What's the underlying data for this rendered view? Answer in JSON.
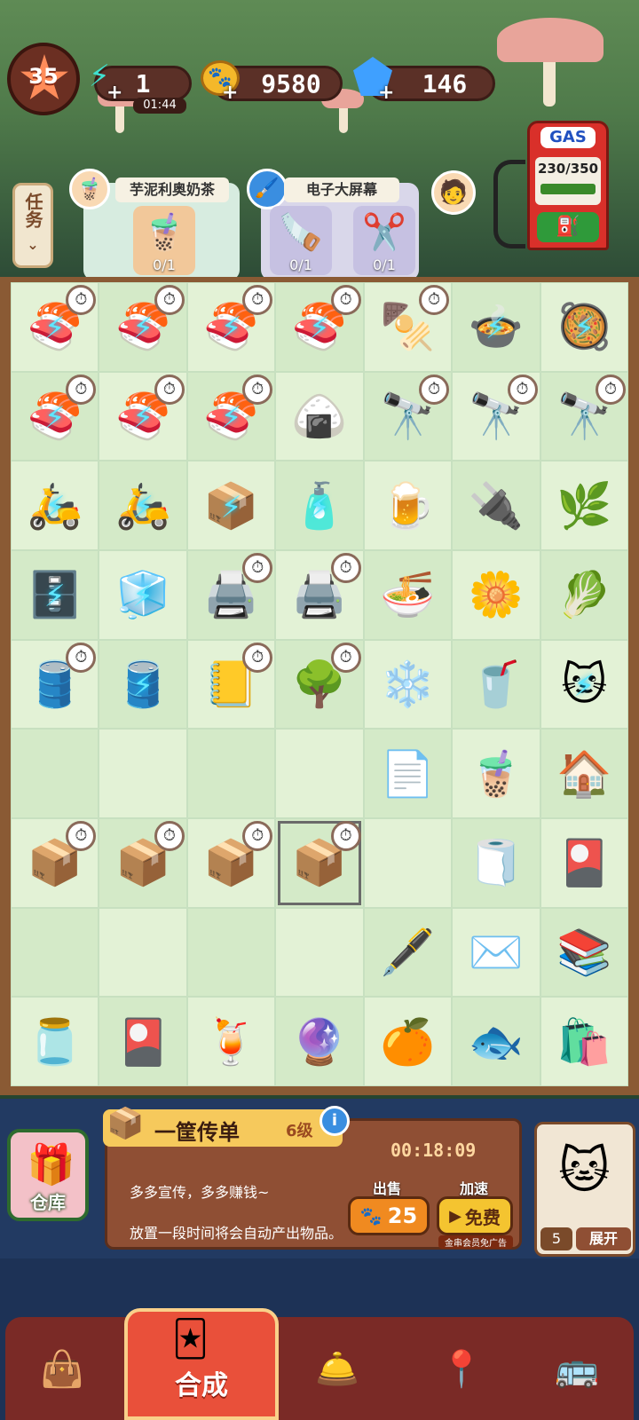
{
  "hud": {
    "level": "35",
    "energy": {
      "value": "1",
      "timer": "01:44",
      "icon": "energy-icon"
    },
    "coins": {
      "value": "9580",
      "icon": "paw-coin-icon"
    },
    "gems": {
      "value": "146",
      "icon": "gem-icon"
    },
    "gas": {
      "label": "GAS",
      "value": "230/350"
    }
  },
  "tasks": {
    "tab_label": "任务",
    "orders": [
      {
        "title": "芋泥利奥奶茶",
        "items": [
          {
            "icon": "bubble-tea-icon",
            "glyph": "🧋",
            "progress": "0/1"
          }
        ]
      },
      {
        "title": "电子大屏幕",
        "items": [
          {
            "icon": "saw-icon",
            "glyph": "🪚",
            "progress": "0/1"
          },
          {
            "icon": "eyelash-curler-icon",
            "glyph": "✂️",
            "progress": "0/1"
          }
        ]
      }
    ]
  },
  "board": {
    "rows": [
      [
        {
          "icon": "sushi-roll-icon",
          "g": "🍣",
          "lock": true,
          "timer": true
        },
        {
          "icon": "sushi-roll-icon",
          "g": "🍣",
          "lock": true,
          "timer": true
        },
        {
          "icon": "sushi-roll-icon",
          "g": "🍣",
          "lock": true,
          "timer": true
        },
        {
          "icon": "sushi-roll-icon",
          "g": "🍣",
          "lock": true,
          "timer": true
        },
        {
          "icon": "hotpot-icon",
          "g": "🍢",
          "lock": false,
          "timer": true
        },
        {
          "icon": "stew-pot-icon",
          "g": "🍲",
          "lock": true,
          "timer": false
        },
        {
          "icon": "soup-bowl-icon",
          "g": "🥘",
          "lock": true,
          "timer": false
        }
      ],
      [
        {
          "icon": "sushi-roll-icon",
          "g": "🍣",
          "lock": true,
          "timer": true
        },
        {
          "icon": "sushi-roll-icon",
          "g": "🍣",
          "lock": true,
          "timer": true
        },
        {
          "icon": "sushi-roll-icon",
          "g": "🍣",
          "lock": true,
          "timer": true
        },
        {
          "icon": "sushi-roll-icon",
          "g": "🍙",
          "lock": false,
          "timer": false
        },
        {
          "icon": "telescope-icon",
          "g": "🔭",
          "lock": false,
          "timer": true
        },
        {
          "icon": "telescope-icon",
          "g": "🔭",
          "lock": false,
          "timer": true
        },
        {
          "icon": "telescope-icon",
          "g": "🔭",
          "lock": false,
          "timer": true
        }
      ],
      [
        {
          "icon": "scooter-icon",
          "g": "🛵",
          "lock": true,
          "timer": false
        },
        {
          "icon": "scooter-icon",
          "g": "🛵",
          "lock": true,
          "timer": false
        },
        {
          "icon": "crafts-box-icon",
          "g": "📦",
          "lock": true,
          "timer": false
        },
        {
          "icon": "bottles-crate-icon",
          "g": "🧴",
          "lock": true,
          "timer": false
        },
        {
          "icon": "beer-glass-icon",
          "g": "🍺",
          "lock": false,
          "timer": false
        },
        {
          "icon": "plug-icon",
          "g": "🔌",
          "lock": false,
          "timer": false
        },
        {
          "icon": "herbs-board-icon",
          "g": "🌿",
          "lock": false,
          "timer": false
        }
      ],
      [
        {
          "icon": "safe-icon",
          "g": "🗄️",
          "lock": true,
          "timer": false
        },
        {
          "icon": "fridge-icon",
          "g": "🧊",
          "lock": true,
          "timer": false
        },
        {
          "icon": "printer-icon",
          "g": "🖨️",
          "lock": false,
          "timer": true
        },
        {
          "icon": "printer-icon",
          "g": "🖨️",
          "lock": false,
          "timer": true
        },
        {
          "icon": "noodle-bowl-icon",
          "g": "🍜",
          "lock": false,
          "timer": false
        },
        {
          "icon": "flower-icon",
          "g": "🌼",
          "lock": false,
          "timer": false
        },
        {
          "icon": "cabbage-icon",
          "g": "🥬",
          "lock": false,
          "timer": false
        }
      ],
      [
        {
          "icon": "barrel-icon",
          "g": "🛢️",
          "lock": false,
          "timer": true
        },
        {
          "icon": "barrel-icon",
          "g": "🛢️",
          "lock": true,
          "timer": false
        },
        {
          "icon": "notebook-icon",
          "g": "📒",
          "lock": false,
          "timer": true
        },
        {
          "icon": "tree-icon",
          "g": "🌳",
          "lock": false,
          "timer": true
        },
        {
          "icon": "snowflake-icon",
          "g": "❄️",
          "lock": false,
          "timer": false
        },
        {
          "icon": "purple-drink-icon",
          "g": "🥤",
          "lock": false,
          "timer": false
        },
        {
          "icon": "lucky-cat-icon",
          "g": "🐱",
          "lock": true,
          "timer": false
        }
      ],
      [
        {
          "icon": "",
          "g": "",
          "lock": false,
          "timer": false
        },
        {
          "icon": "",
          "g": "",
          "lock": false,
          "timer": false
        },
        {
          "icon": "",
          "g": "",
          "lock": false,
          "timer": false
        },
        {
          "icon": "",
          "g": "",
          "lock": false,
          "timer": false
        },
        {
          "icon": "paper-plane-icon",
          "g": "📄",
          "lock": false,
          "timer": false
        },
        {
          "icon": "iced-cola-icon",
          "g": "🧋",
          "lock": false,
          "timer": false
        },
        {
          "icon": "house-icon",
          "g": "🏠",
          "lock": false,
          "timer": false
        }
      ],
      [
        {
          "icon": "flyer-box-icon",
          "g": "📦",
          "lock": false,
          "timer": true
        },
        {
          "icon": "flyer-box-icon",
          "g": "📦",
          "lock": false,
          "timer": true
        },
        {
          "icon": "flyer-box-icon",
          "g": "📦",
          "lock": false,
          "timer": true
        },
        {
          "icon": "flyer-box-icon",
          "g": "📦",
          "lock": false,
          "timer": true
        },
        {
          "icon": "",
          "g": "",
          "lock": false,
          "timer": false
        },
        {
          "icon": "paper-sheet-icon",
          "g": "🧻",
          "lock": false,
          "timer": false
        },
        {
          "icon": "flyer-cards-icon",
          "g": "🎴",
          "lock": false,
          "timer": false
        }
      ],
      [
        {
          "icon": "",
          "g": "",
          "lock": false,
          "timer": false
        },
        {
          "icon": "",
          "g": "",
          "lock": false,
          "timer": false
        },
        {
          "icon": "",
          "g": "",
          "lock": false,
          "timer": false
        },
        {
          "icon": "",
          "g": "",
          "lock": false,
          "timer": false
        },
        {
          "icon": "fountain-pen-icon",
          "g": "🖋️",
          "lock": false,
          "timer": false
        },
        {
          "icon": "envelope-icon",
          "g": "✉️",
          "lock": false,
          "timer": false
        },
        {
          "icon": "paper-stack-icon",
          "g": "📚",
          "lock": false,
          "timer": false
        }
      ],
      [
        {
          "icon": "jam-jar-icon",
          "g": "🫙",
          "lock": false,
          "timer": false
        },
        {
          "icon": "flyer-cards-icon",
          "g": "🎴",
          "lock": false,
          "timer": false
        },
        {
          "icon": "berry-drink-icon",
          "g": "🍹",
          "lock": false,
          "timer": false
        },
        {
          "icon": "crystal-ball-icon",
          "g": "🔮",
          "lock": false,
          "timer": false
        },
        {
          "icon": "orange-juice-icon",
          "g": "🍊",
          "lock": false,
          "timer": false
        },
        {
          "icon": "fish-figure-icon",
          "g": "🐟",
          "lock": false,
          "timer": false
        },
        {
          "icon": "shopping-bag-icon",
          "g": "🛍️",
          "lock": false,
          "timer": false
        }
      ]
    ]
  },
  "selected": {
    "title": "一筐传单",
    "level": "6级",
    "timer": "00:18:09",
    "desc1": "多多宣传，多多赚钱~",
    "desc2": "放置一段时间将会自动产出物品。",
    "sell_caption": "出售",
    "sell_price": "25",
    "speed_caption": "加速",
    "speed_label": "免费",
    "speed_note": "金串会员免广告"
  },
  "warehouse": {
    "label": "仓库"
  },
  "side_panel": {
    "count": "5",
    "expand": "展开"
  },
  "nav": {
    "merge_label": "合成"
  }
}
